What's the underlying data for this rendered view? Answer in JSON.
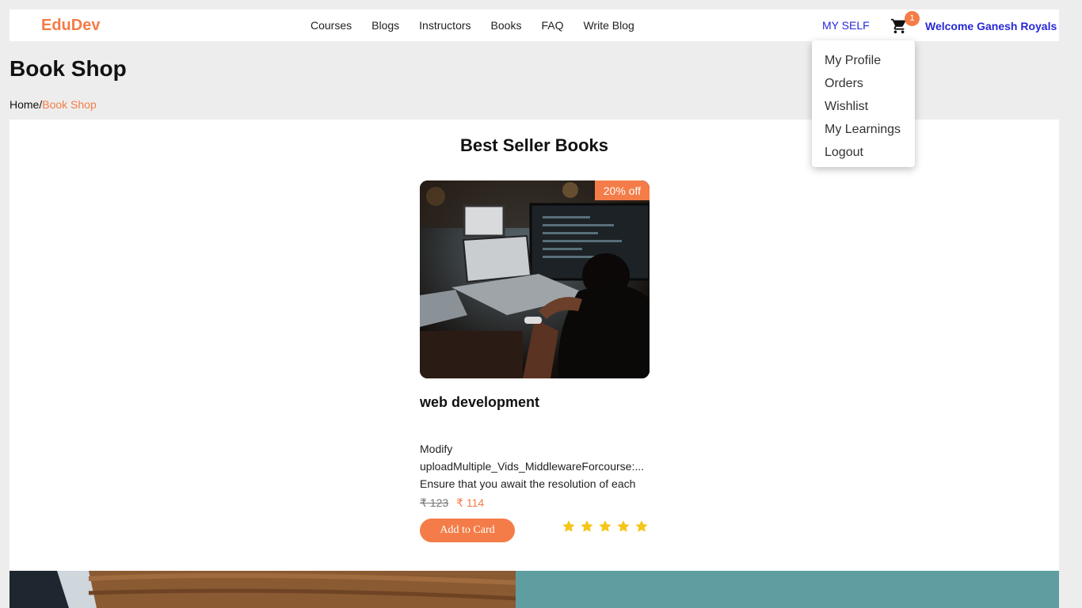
{
  "brand": {
    "logo": "EduDev",
    "accent_color": "#f47c48",
    "link_color": "#2828d8"
  },
  "nav": {
    "links": [
      "Courses",
      "Blogs",
      "Instructors",
      "Books",
      "FAQ",
      "Write Blog"
    ],
    "myself": "MY SELF",
    "cart_count": "1",
    "cart_icon": "shopping-cart-icon",
    "welcome": "Welcome Ganesh Royals"
  },
  "dropdown": {
    "items": [
      "My Profile",
      "Orders",
      "Wishlist",
      "My Learnings",
      "Logout"
    ]
  },
  "page": {
    "title": "Book Shop",
    "breadcrumb": {
      "home": "Home",
      "separator": "/",
      "current": "Book Shop"
    }
  },
  "section": {
    "title": "Best Seller Books"
  },
  "book": {
    "discount": "20% off",
    "title": "web development",
    "description_lines": [
      "Modify",
      "uploadMultiple_Vids_MiddlewareForcourse:...",
      "Ensure that you await the resolution of each"
    ],
    "old_price": "₹ 123",
    "new_price": "₹ 114",
    "add_button": "Add to Card",
    "rating": 5,
    "star_icon": "star-icon",
    "star_color": "#f5c518"
  }
}
